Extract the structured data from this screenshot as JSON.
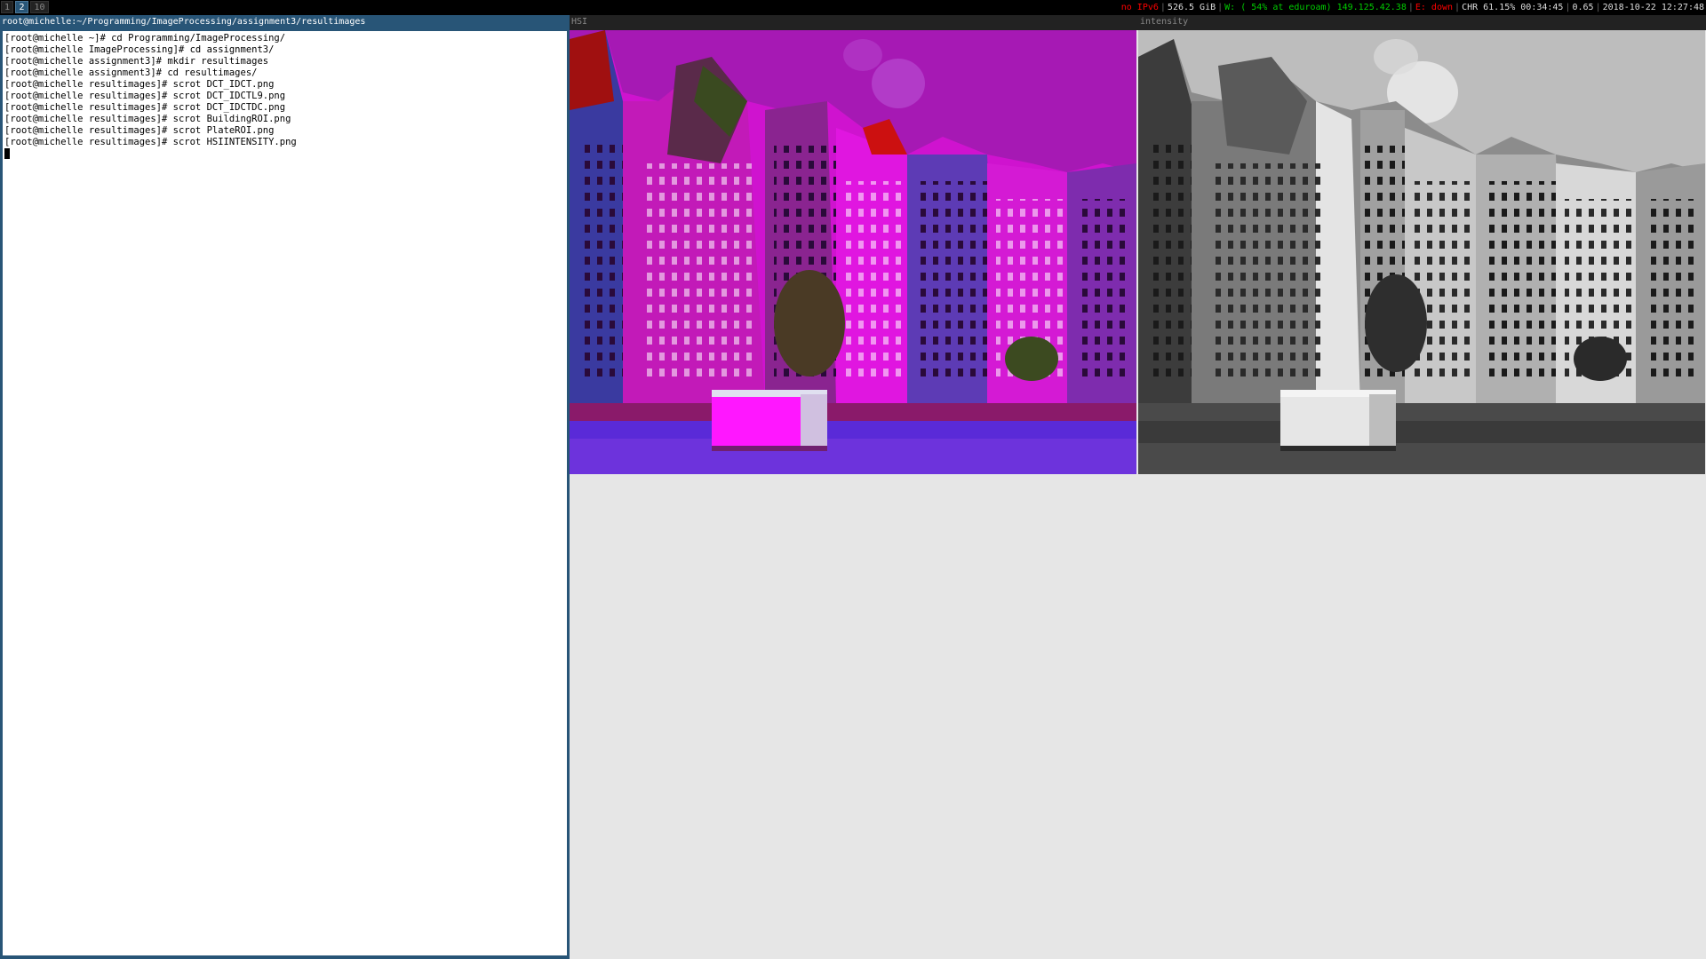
{
  "workspaces": [
    {
      "label": "1",
      "focused": false
    },
    {
      "label": "2",
      "focused": true
    },
    {
      "label": "10",
      "focused": false
    }
  ],
  "status": {
    "ipv6": "no IPv6",
    "disk": "526.5 GiB",
    "wifi": "W: ( 54% at eduroam) 149.125.42.38",
    "ethernet": "E: down",
    "battery": "CHR 61.15% 00:34:45",
    "load": "0.65",
    "datetime": "2018-10-22 12:27:48",
    "colors": {
      "ok": "#00cc00",
      "bad": "#ff0000",
      "text": "#dddddd"
    }
  },
  "terminal": {
    "title": "root@michelle:~/Programming/ImageProcessing/assignment3/resultimages",
    "lines": [
      "[root@michelle ~]# cd Programming/ImageProcessing/",
      "[root@michelle ImageProcessing]# cd assignment3/",
      "[root@michelle assignment3]# mkdir resultimages",
      "[root@michelle assignment3]# cd resultimages/",
      "[root@michelle resultimages]# scrot DCT_IDCT.png",
      "[root@michelle resultimages]# scrot DCT_IDCTL9.png",
      "[root@michelle resultimages]# scrot DCT_IDCTDC.png",
      "[root@michelle resultimages]# scrot BuildingROI.png",
      "[root@michelle resultimages]# scrot PlateROI.png",
      "[root@michelle resultimages]# scrot HSIINTENSITY.png"
    ]
  },
  "windows": {
    "hsi_title": "HSI",
    "intensity_title": "intensity"
  },
  "colors": {
    "focused_border": "#285577",
    "unfocused": "#222222",
    "image_bg": "#e6e6e6"
  }
}
